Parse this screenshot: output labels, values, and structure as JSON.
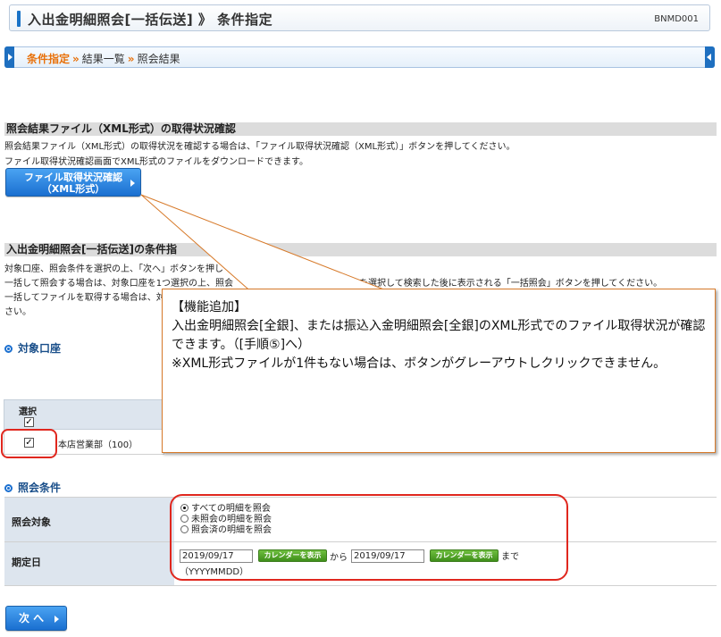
{
  "header": {
    "title": "入出金明細照会[一括伝送] 》 条件指定",
    "code": "BNMD001"
  },
  "steps": {
    "current": "条件指定",
    "sep1": "»",
    "second": "結果一覧",
    "sep2": "»",
    "third": "照会結果"
  },
  "xml_section": {
    "title": "照会結果ファイル（XML形式）の取得状況確認",
    "line1": "照会結果ファイル（XML形式）の取得状況を確認する場合は、「ファイル取得状況確認（XML形式）」ボタンを押してください。",
    "line2": "ファイル取得状況確認画面でXML形式のファイルをダウンロードできます。",
    "button_line1": "ファイル取得状況確認",
    "button_line2": "（XML形式）"
  },
  "cond_section": {
    "title": "入出金明細照会[一括伝送]の条件指",
    "line1": "対象口座、照会条件を選択の上、「次へ」ボタンを押し",
    "line2a": "一括して照会する場合は、対象口座を1つ選択の上、照会",
    "line2b": "を選択して検索した後に表示される「一括照会」ボタンを押してください。",
    "line3": "一括してファイルを取得する場合は、対",
    "line4": "さい。"
  },
  "callout": {
    "heading": "【機能追加】",
    "line1": "入出金明細照会[全銀]、または振込入金明細照会[全銀]のXML形式でのファイル取得状況が確認できます。（[手順⑤]へ）",
    "line2": "※XML形式ファイルが1件もない場合は、ボタンがグレーアウトしクリックできません。"
  },
  "accounts": {
    "heading": "対象口座",
    "col_select": "選択",
    "row_name": "本店営業部（100）",
    "header_checked": true,
    "row_checked": true
  },
  "conditions": {
    "heading": "照会条件",
    "target_label": "照会対象",
    "options": [
      "すべての明細を照会",
      "未照会の明細を照会",
      "照会済の明細を照会"
    ],
    "selected_index": 0,
    "date_label": "期定日",
    "date_from": "2019/09/17",
    "date_to": "2019/09/17",
    "calendar_label": "カレンダーを表示",
    "from_text": "から",
    "to_text": "まで",
    "date_format": "（YYYYMMDD）"
  },
  "next_button": "次 へ"
}
